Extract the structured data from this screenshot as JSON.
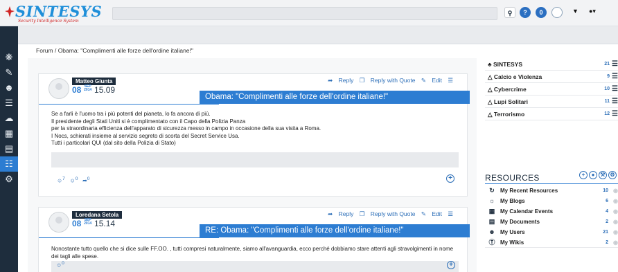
{
  "app": {
    "logo_name": "SINTESYS",
    "logo_tagline": "Security Intelligence System"
  },
  "topbar": {
    "search_placeholder": "",
    "help_label": "?",
    "notif_count": "0"
  },
  "breadcrumb": {
    "root": "Forum",
    "separator": "/",
    "current": "Obama: \"Complimenti alle forze dell'ordine italiane!\""
  },
  "actions": {
    "reply": "Reply",
    "reply_quote": "Reply with Quote",
    "edit": "Edit"
  },
  "posts": [
    {
      "author": "Matteo Giunta",
      "day": "08",
      "month": "SEP",
      "year": "2014",
      "time": "15.09",
      "title": "Obama: \"Complimenti alle forze dell'ordine italiane!\"",
      "lines": [
        "Se a farli è l'uomo tra i più potenti del pianeta, lo fa ancora di più.",
        "Il presidente degli Stati Uniti si è complimentato con il Capo della Polizia Panza",
        "per la straordinaria efficienza dell'apparato di sicurezza messo in campo in occasione della sua visita a Roma.",
        "I Nocs, schierati insieme al servizio segreto di scorta del Secret Service Usa.",
        "Tutti i particolari QUI (dal sito della Polizia di Stato)"
      ],
      "reactions": [
        "7",
        "0",
        "0"
      ]
    },
    {
      "author": "Loredana Setola",
      "day": "08",
      "month": "SEP",
      "year": "2014",
      "time": "15.14",
      "title": "RE: Obama: \"Complimenti alle forze dell'ordine italiane!\"",
      "lines": [
        "Nonostante tutto quello che si dice sulle FF.OO. , tutti compresi naturalmente, siamo all'avanguardia, ecco perché dobbiamo stare attenti agli stravolgimenti in nome dei tagli alle spese."
      ],
      "reactions": [
        "0"
      ]
    }
  ],
  "forums": [
    {
      "name": "SINTESYS",
      "count": "21"
    },
    {
      "name": "Calcio e Violenza",
      "count": "9"
    },
    {
      "name": "Cybercrime",
      "count": "10"
    },
    {
      "name": "Lupi Solitari",
      "count": "11"
    },
    {
      "name": "Terrorismo",
      "count": "12"
    }
  ],
  "resources": {
    "title": "RESOURCES",
    "items": [
      {
        "label": "My Recent Resources",
        "count": "10"
      },
      {
        "label": "My Blogs",
        "count": "6"
      },
      {
        "label": "My Calendar Events",
        "count": "4"
      },
      {
        "label": "My Documents",
        "count": "2"
      },
      {
        "label": "My Users",
        "count": "21"
      },
      {
        "label": "My Wikis",
        "count": "2"
      }
    ]
  },
  "colors": {
    "accent": "#2d7dd2",
    "sidebar": "#1e2d3d",
    "logo_red": "#d02323"
  }
}
